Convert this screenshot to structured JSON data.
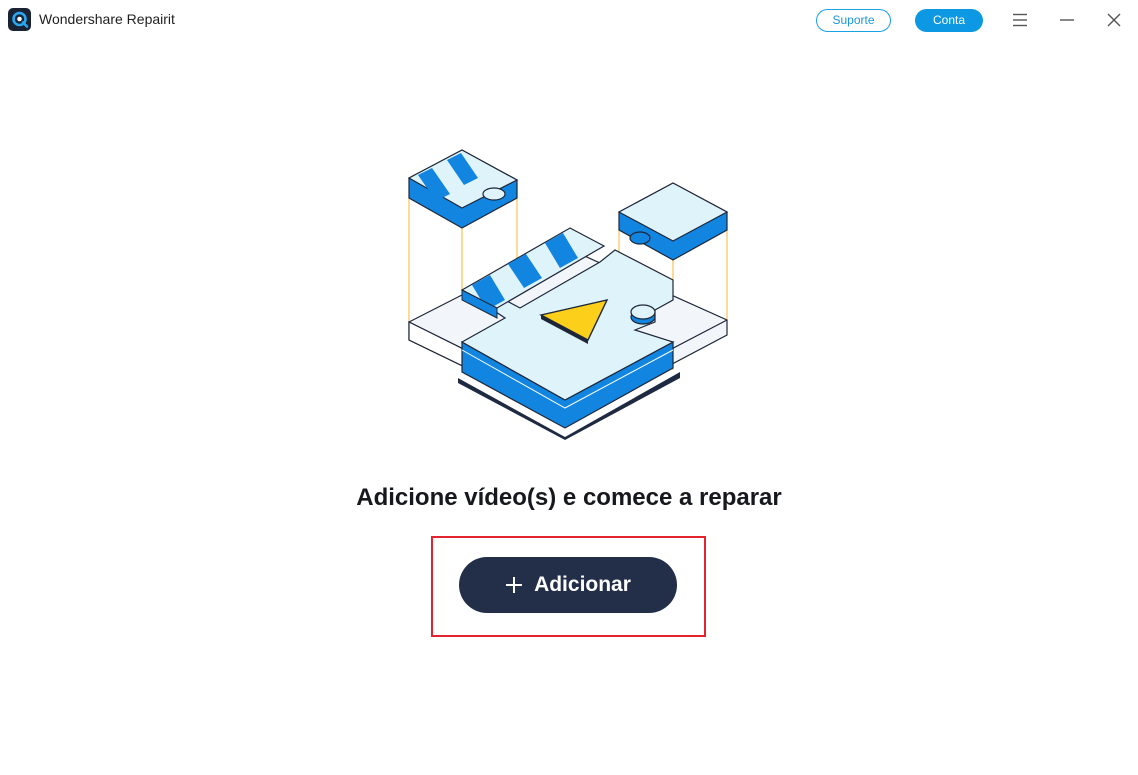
{
  "app": {
    "title": "Wondershare Repairit"
  },
  "header": {
    "support_label": "Suporte",
    "account_label": "Conta",
    "accent_color": "#0d98e3"
  },
  "main": {
    "heading": "Adicione vídeo(s) e comece a reparar",
    "add_button_label": "Adicionar",
    "button_color": "#232f48",
    "highlight_color": "#e5232f"
  },
  "icons": {
    "logo": "repairit-logo-icon",
    "menu": "hamburger-menu-icon",
    "minimize": "minimize-icon",
    "close": "close-icon",
    "plus": "plus-icon",
    "illustration": "video-puzzle-illustration"
  }
}
